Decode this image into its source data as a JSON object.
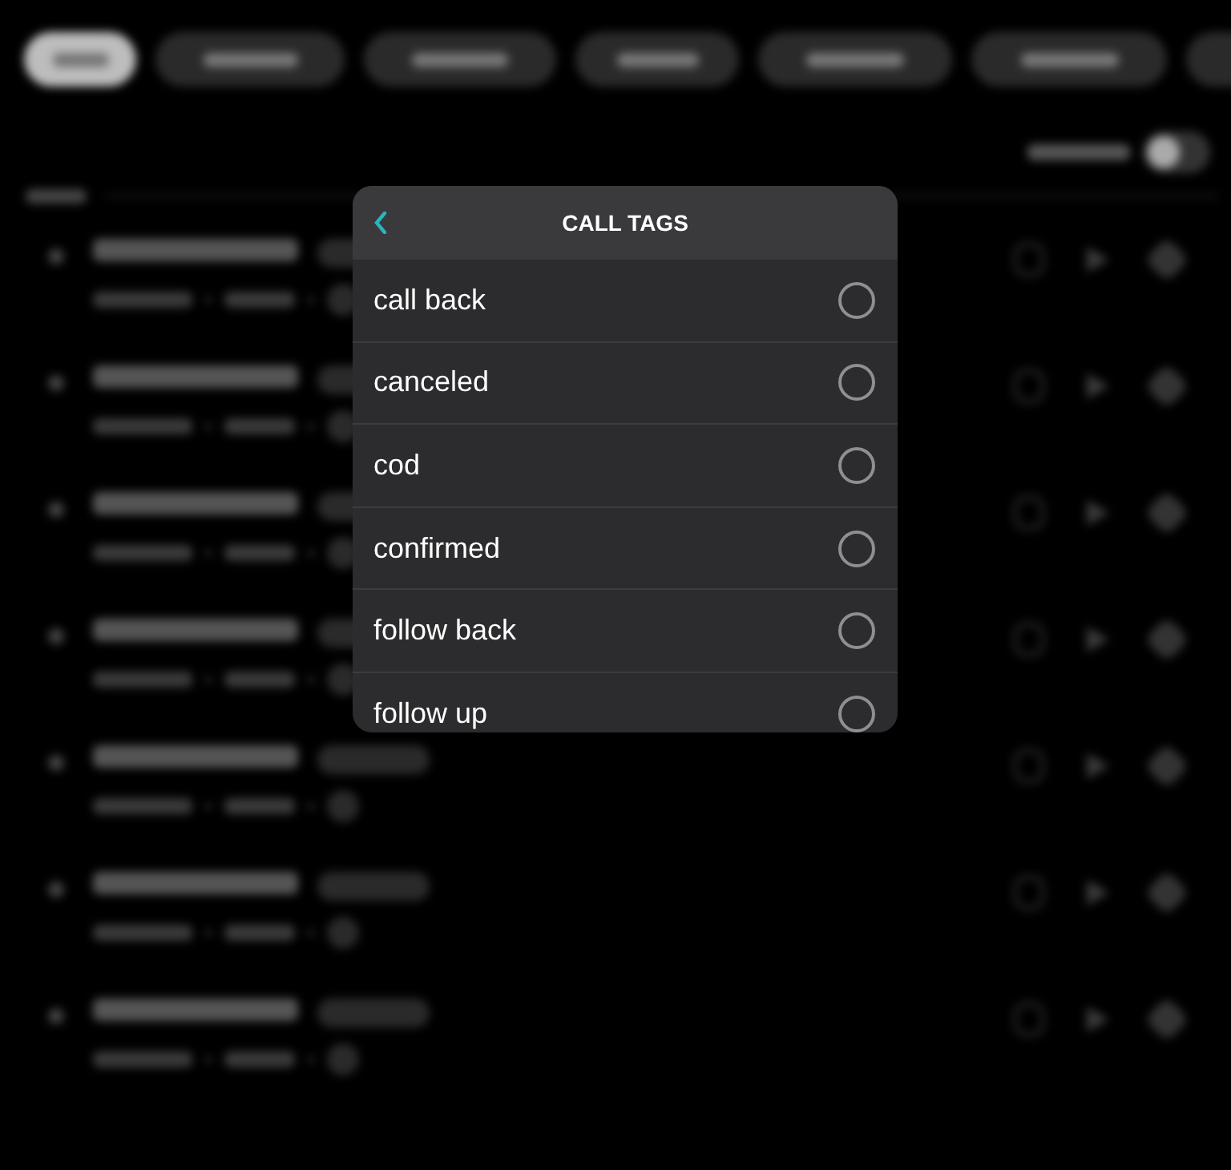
{
  "filters": [
    {
      "selected": true
    },
    {
      "selected": false
    },
    {
      "selected": false
    },
    {
      "selected": false
    },
    {
      "selected": false
    },
    {
      "selected": false
    }
  ],
  "show_info": {
    "on": false
  },
  "call_rows": [
    {
      "kind": "entry"
    },
    {
      "kind": "entry"
    },
    {
      "kind": "entry"
    },
    {
      "kind": "entry"
    },
    {
      "kind": "entry"
    },
    {
      "kind": "entry"
    },
    {
      "kind": "entry"
    }
  ],
  "modal": {
    "title": "CALL TAGS",
    "tags": [
      {
        "label": "call back",
        "selected": false
      },
      {
        "label": "canceled",
        "selected": false
      },
      {
        "label": "cod",
        "selected": false
      },
      {
        "label": "confirmed",
        "selected": false
      },
      {
        "label": "follow back",
        "selected": false
      },
      {
        "label": "follow up",
        "selected": false
      }
    ]
  }
}
